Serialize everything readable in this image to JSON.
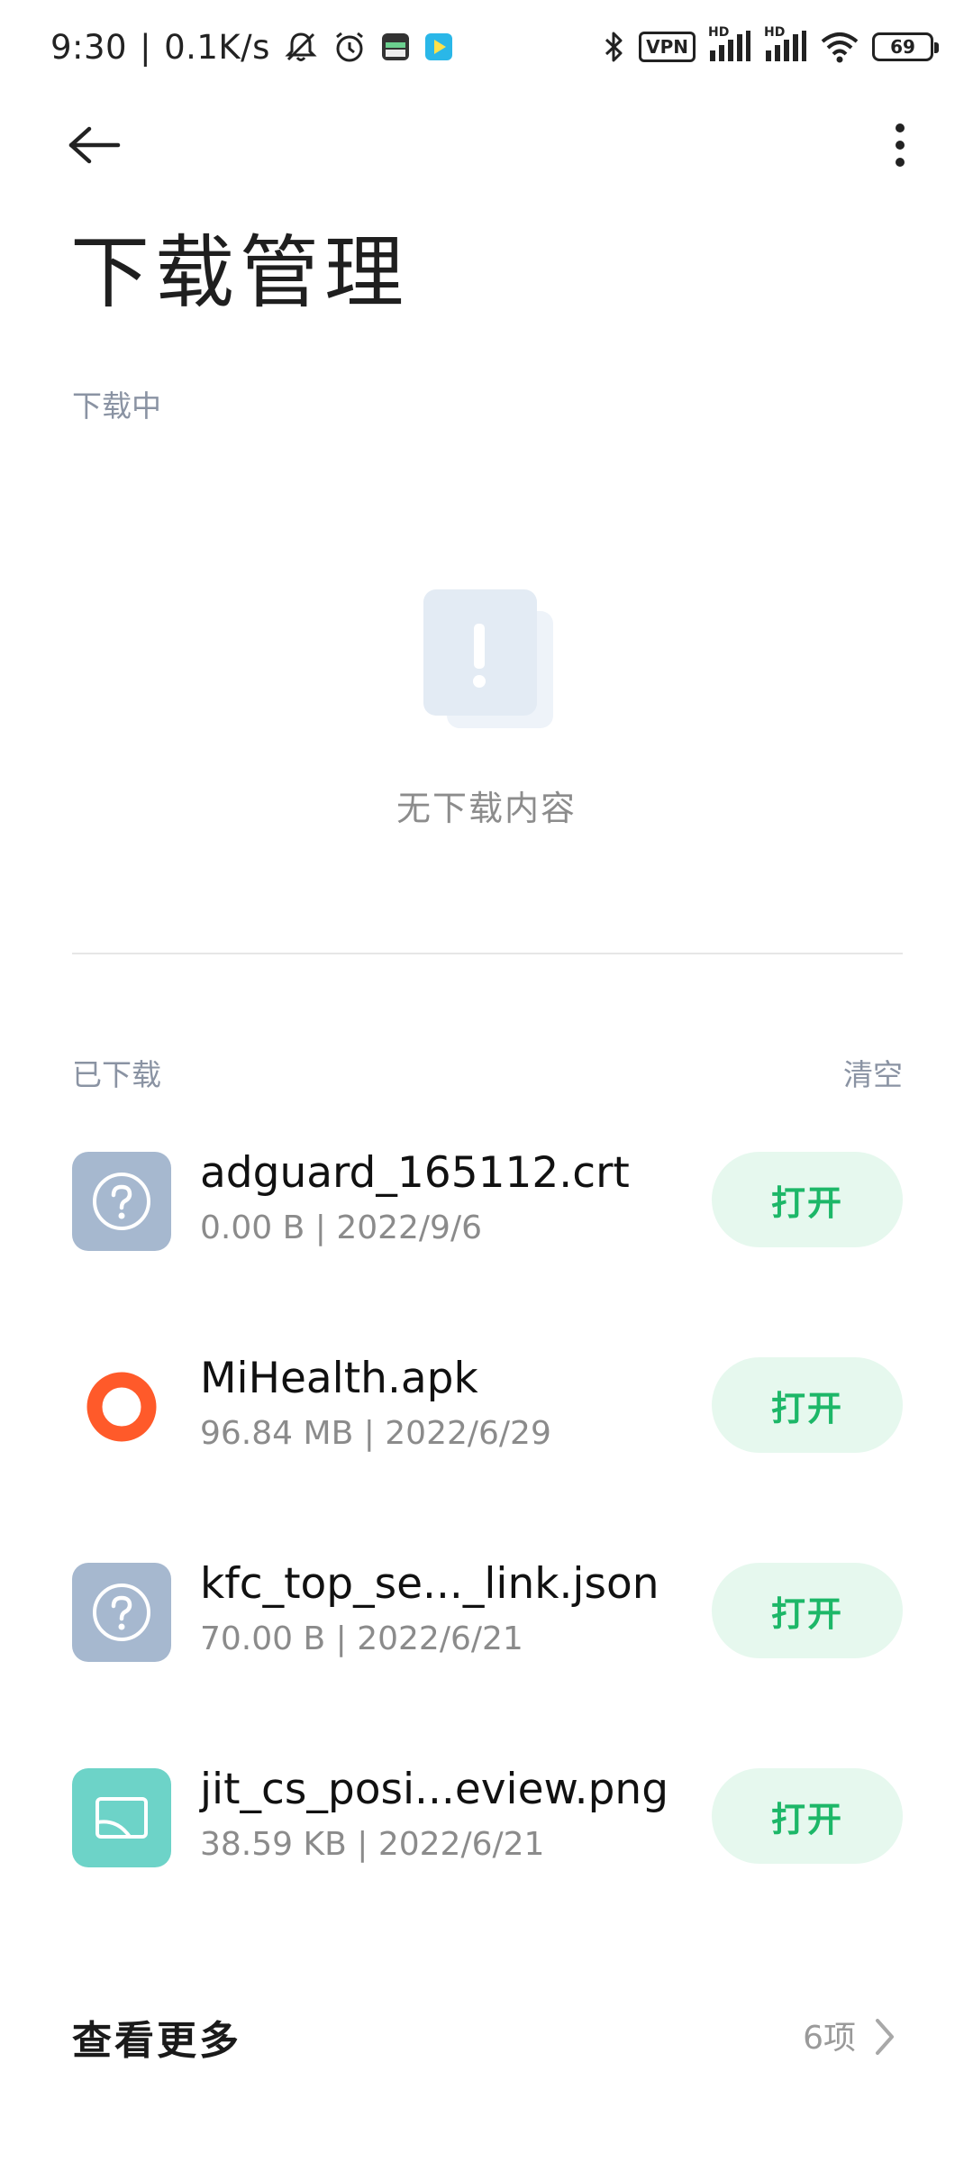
{
  "status_bar": {
    "time": "9:30",
    "separator": "|",
    "net_speed": "0.1K/s",
    "vpn": "VPN",
    "hd1": "HD",
    "hd2": "HD",
    "battery": "69",
    "icons": [
      "notifications-off-icon",
      "alarm-icon",
      "app-icon",
      "play-store-icon",
      "bluetooth-icon",
      "vpn-icon",
      "signal-icon",
      "signal-icon",
      "wifi-icon",
      "battery-icon"
    ]
  },
  "header": {
    "title": "下载管理",
    "back_icon": "arrow-left-icon",
    "more_icon": "more-vertical-icon"
  },
  "downloading": {
    "label": "下载中",
    "empty_text": "无下载内容"
  },
  "downloaded": {
    "label": "已下载",
    "clear_label": "清空",
    "items": [
      {
        "name": "adguard_165112.crt",
        "meta": "0.00 B | 2022/9/6",
        "icon": "unknown-file-icon",
        "action": "打开"
      },
      {
        "name": "MiHealth.apk",
        "meta": "96.84 MB | 2022/6/29",
        "icon": "mihealth-app-icon",
        "action": "打开"
      },
      {
        "name": "kfc_top_se..._link.json",
        "meta": "70.00 B | 2022/6/21",
        "icon": "unknown-file-icon",
        "action": "打开"
      },
      {
        "name": "jit_cs_posi...eview.png",
        "meta": "38.59 KB | 2022/6/21",
        "icon": "image-file-icon",
        "action": "打开"
      }
    ]
  },
  "see_more": {
    "label": "查看更多",
    "count": "6项"
  },
  "colors": {
    "accent_green": "#1db768",
    "button_bg": "#e6f8ee",
    "label_gray": "#8a93a3",
    "unknown_icon_bg": "#a6b8cf",
    "image_icon_bg": "#6dd3c8",
    "mihealth_orange": "#ff5a2a"
  }
}
